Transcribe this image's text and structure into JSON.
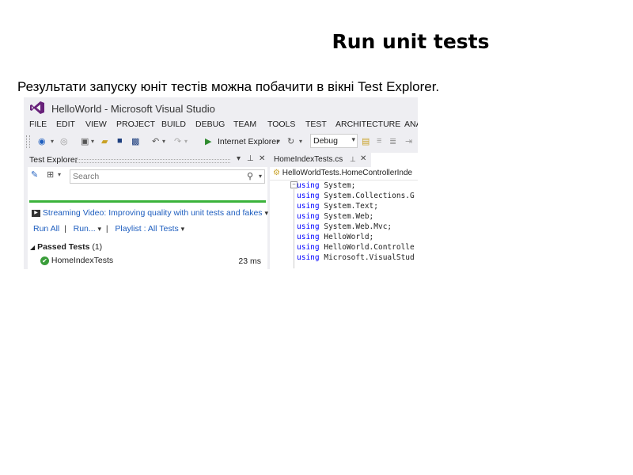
{
  "slide": {
    "title": "Run unit tests",
    "subtitle": "Результати запуску юніт тестів можна побачити в вікні Test Explorer."
  },
  "window": {
    "title": "HelloWorld - Microsoft Visual Studio",
    "logo_icon": "visual-studio-logo-icon",
    "accent_color": "#68217a"
  },
  "menu": [
    "FILE",
    "EDIT",
    "VIEW",
    "PROJECT",
    "BUILD",
    "DEBUG",
    "TEAM",
    "TOOLS",
    "TEST",
    "ARCHITECTURE",
    "ANA"
  ],
  "toolbar": {
    "run_target": "Internet Explorer",
    "configuration": "Debug"
  },
  "test_explorer": {
    "title": "Test Explorer",
    "search_placeholder": "Search",
    "streaming_video": "Streaming Video: Improving quality with unit tests and fakes",
    "run_all": "Run All",
    "run": "Run...",
    "playlist": "Playlist : All Tests",
    "group_label": "Passed Tests",
    "group_count": "(1)",
    "tests": [
      {
        "name": "HomeIndexTests",
        "duration": "23 ms",
        "status": "passed"
      }
    ],
    "status_color": "#3bb33b"
  },
  "editor": {
    "tab_label": "HomeIndexTests.cs",
    "nav_label": "HelloWorldTests.HomeControllerInde",
    "lines": [
      {
        "kw": "using",
        "ns": "System;"
      },
      {
        "kw": "using",
        "ns": "System.Collections.G"
      },
      {
        "kw": "using",
        "ns": "System.Text;"
      },
      {
        "kw": "using",
        "ns": "System.Web;"
      },
      {
        "kw": "using",
        "ns": "System.Web.Mvc;"
      },
      {
        "kw": "using",
        "ns": "HelloWorld;"
      },
      {
        "kw": "using",
        "ns": "HelloWorld.Controlle"
      },
      {
        "kw": "using",
        "ns": "Microsoft.VisualStud"
      }
    ]
  }
}
